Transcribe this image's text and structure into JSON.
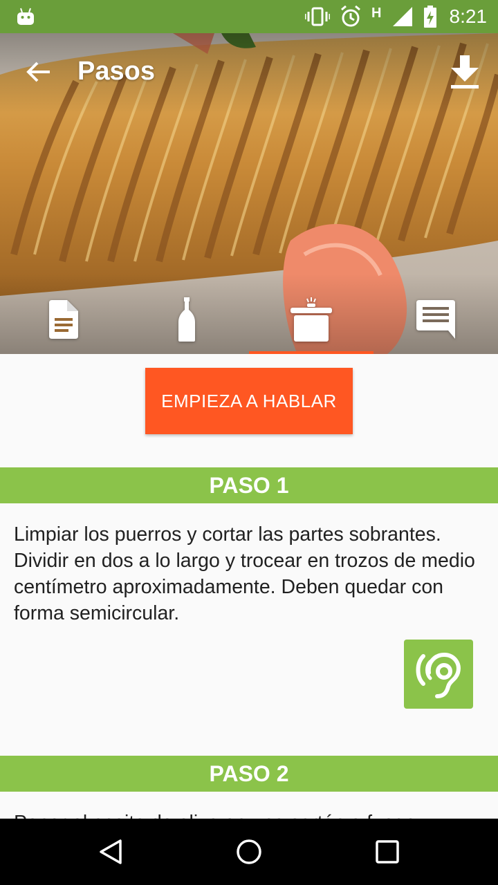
{
  "status_bar": {
    "time": "8:21",
    "network": "H",
    "icons": [
      "android-icon",
      "vibrate-icon",
      "alarm-icon",
      "signal-icon",
      "battery-charging-icon"
    ]
  },
  "toolbar": {
    "title": "Pasos",
    "back_icon": "arrow-back-icon",
    "download_icon": "download-icon"
  },
  "tabs": [
    {
      "icon": "document-icon",
      "selected": false
    },
    {
      "icon": "bottle-icon",
      "selected": false
    },
    {
      "icon": "cooking-pot-icon",
      "selected": true
    },
    {
      "icon": "comment-icon",
      "selected": false
    }
  ],
  "speak_button": {
    "label": "EMPIEZA A HABLAR"
  },
  "steps": [
    {
      "title": "PASO 1",
      "text": "Limpiar los puerros y cortar las partes sobrantes. Dividir en dos a lo largo y trocear en trozos de medio centímetro aproximadamente. Deben quedar con forma semicircular.",
      "listen_icon": "hearing-icon"
    },
    {
      "title": "PASO 2",
      "text": "Poner el aceite de oliva en una sartén a fuego"
    }
  ],
  "colors": {
    "status_bar": "#6a9e3a",
    "accent": "#ff5722",
    "step_header": "#8bc34a"
  },
  "nav_bar": {
    "icons": [
      "back-triangle-icon",
      "home-circle-icon",
      "recents-square-icon"
    ]
  }
}
